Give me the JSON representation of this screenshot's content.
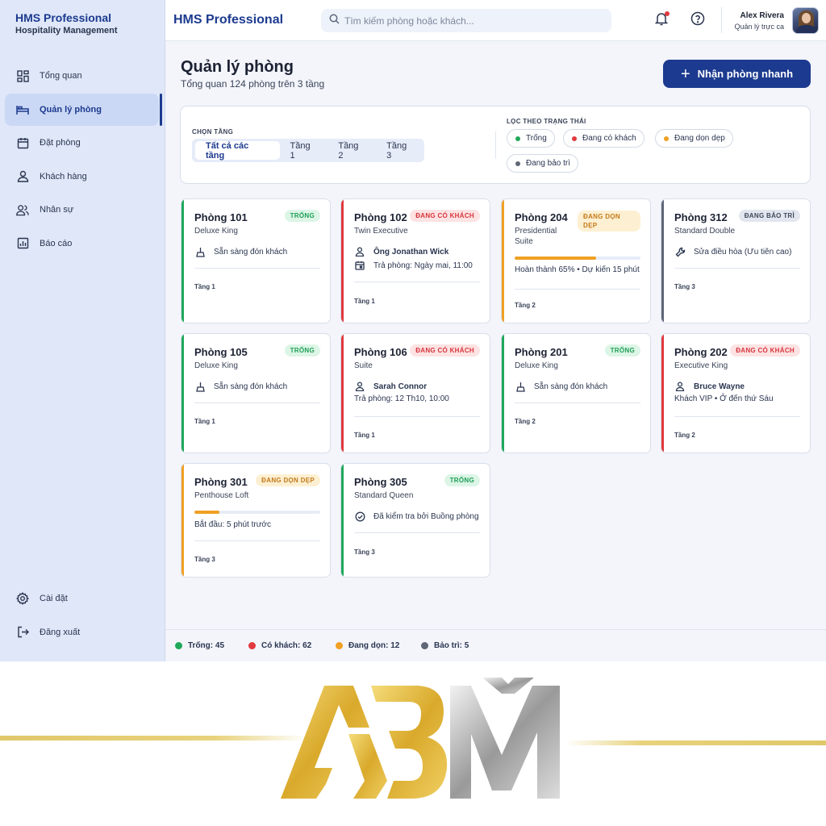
{
  "sidebar": {
    "brand_title": "HMS Professional",
    "brand_sub": "Hospitality Management",
    "items": [
      {
        "label": "Tổng quan",
        "icon": "dashboard-icon"
      },
      {
        "label": "Quản lý phòng",
        "icon": "bed-icon",
        "active": true
      },
      {
        "label": "Đặt phòng",
        "icon": "calendar-icon"
      },
      {
        "label": "Khách hàng",
        "icon": "user-icon"
      },
      {
        "label": "Nhân sự",
        "icon": "users-icon"
      },
      {
        "label": "Báo cáo",
        "icon": "report-icon"
      }
    ],
    "bottom": [
      {
        "label": "Cài đặt",
        "icon": "gear-icon"
      },
      {
        "label": "Đăng xuất",
        "icon": "logout-icon"
      }
    ]
  },
  "topbar": {
    "title": "HMS Professional",
    "search_placeholder": "Tìm kiếm phòng hoặc khách...",
    "user_name": "Alex Rivera",
    "user_role": "Quản lý trực ca"
  },
  "header": {
    "title": "Quản lý phòng",
    "subtitle": "Tổng quan 124 phòng trên 3 tầng",
    "quick_button": "Nhận phòng nhanh"
  },
  "filters": {
    "floor_label": "CHỌN TẦNG",
    "floor_tabs": [
      "Tất cả các tầng",
      "Tầng 1",
      "Tầng 2",
      "Tầng 3"
    ],
    "status_label": "LỌC THEO TRẠNG THÁI",
    "statuses": [
      {
        "label": "Trống",
        "color": "#1fa85a"
      },
      {
        "label": "Đang có khách",
        "color": "#e0393e"
      },
      {
        "label": "Đang dọn dẹp",
        "color": "#f0a023"
      },
      {
        "label": "Đang bảo trì",
        "color": "#5f6676"
      }
    ]
  },
  "colors": {
    "free": "#1fa85a",
    "occupied": "#e0393e",
    "cleaning": "#f0a023",
    "maintenance": "#5f6676",
    "accent": "#1c3a8f"
  },
  "rooms": [
    {
      "name": "Phòng 101",
      "type": "Deluxe King",
      "badge": "TRỐNG",
      "line1": "Sẵn sàng đón khách",
      "floor": "Tầng 1"
    },
    {
      "name": "Phòng 102",
      "type": "Twin Executive",
      "badge": "ĐANG CÓ KHÁCH",
      "guest": "Ông Jonathan Wick",
      "line2": "Trả phòng: Ngày mai, 11:00",
      "floor": "Tầng 1"
    },
    {
      "name": "Phòng 204",
      "type": "Presidential Suite",
      "badge": "ĐANG DỌN DẸP",
      "progress": 0.65,
      "line1": "Hoàn thành 65% • Dự kiến 15 phút",
      "floor": "Tầng 2"
    },
    {
      "name": "Phòng 312",
      "type": "Standard Double",
      "badge": "ĐANG BẢO TRÌ",
      "line1": "Sửa điều hòa (Ưu tiên cao)",
      "floor": "Tầng 3"
    },
    {
      "name": "Phòng 105",
      "type": "Deluxe King",
      "badge": "TRỐNG",
      "line1": "Sẵn sàng đón khách",
      "floor": "Tầng 1"
    },
    {
      "name": "Phòng 106",
      "type": "Suite",
      "badge": "ĐANG CÓ KHÁCH",
      "guest": "Sarah Connor",
      "line2": "Trả phòng: 12 Th10, 10:00",
      "floor": "Tầng 1"
    },
    {
      "name": "Phòng 201",
      "type": "Deluxe King",
      "badge": "TRỐNG",
      "line1": "Sẵn sàng đón khách",
      "floor": "Tầng 2"
    },
    {
      "name": "Phòng 202",
      "type": "Executive King",
      "badge": "ĐANG CÓ KHÁCH",
      "guest": "Bruce Wayne",
      "line2": "Khách VIP • Ở đến thứ Sáu",
      "floor": "Tầng 2"
    },
    {
      "name": "Phòng 301",
      "type": "Penthouse Loft",
      "badge": "ĐANG DỌN DẸP",
      "progress": 0.2,
      "line1": "Bắt đầu: 5 phút trước",
      "floor": "Tầng 3"
    },
    {
      "name": "Phòng 305",
      "type": "Standard Queen",
      "badge": "TRỐNG",
      "line1": "Đã kiểm tra bởi Buồng phòng",
      "floor": "Tầng 3"
    }
  ],
  "footer": {
    "stats": [
      {
        "label": "Trống: 45"
      },
      {
        "label": "Có khách: 62"
      },
      {
        "label": "Đang dọn: 12"
      },
      {
        "label": "Bảo trì: 5"
      }
    ]
  }
}
